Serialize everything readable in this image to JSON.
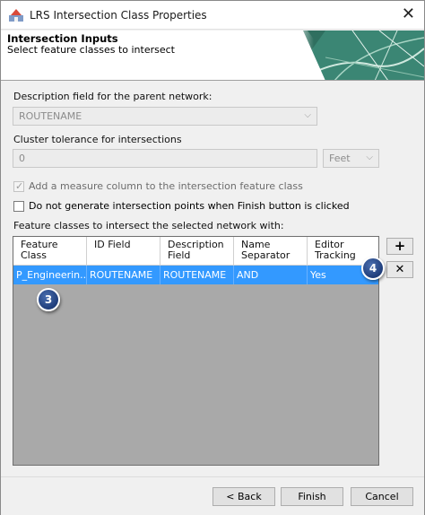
{
  "window": {
    "title": "LRS Intersection Class Properties",
    "close_glyph": "✕"
  },
  "banner": {
    "title": "Intersection Inputs",
    "subtitle": "Select feature classes to intersect"
  },
  "description_field": {
    "label": "Description field for the parent network:",
    "value": "ROUTENAME",
    "enabled": false
  },
  "cluster_tolerance": {
    "label": "Cluster tolerance for intersections",
    "value": "0",
    "unit": "Feet",
    "enabled": false
  },
  "checkboxes": {
    "add_measure": {
      "label": "Add a measure column to the intersection feature class",
      "checked": true,
      "enabled": false
    },
    "no_generate": {
      "label": "Do not generate intersection points when Finish button is clicked",
      "checked": false,
      "enabled": true
    }
  },
  "feature_classes": {
    "label": "Feature classes to intersect the selected network with:",
    "columns": [
      "Feature\nClass",
      "ID Field",
      "Description\nField",
      "Name\nSeparator",
      "Editor\nTracking"
    ],
    "rows": [
      [
        "P_Engineerin...",
        "ROUTENAME",
        "ROUTENAME",
        "AND",
        "Yes"
      ]
    ],
    "selected_row": 0
  },
  "side_buttons": {
    "add": "+",
    "remove": "✕"
  },
  "callouts": {
    "three": "3",
    "four": "4"
  },
  "footer": {
    "back": "< Back",
    "finish": "Finish",
    "cancel": "Cancel"
  },
  "colors": {
    "selection": "#3399ff",
    "grid_background": "#a9a9a9",
    "callout": "#2b4a8a"
  },
  "icons": {
    "app": "lrs-app-icon",
    "dropdown": "chevron-down-icon",
    "add": "plus-icon",
    "remove": "delete-x-icon"
  }
}
